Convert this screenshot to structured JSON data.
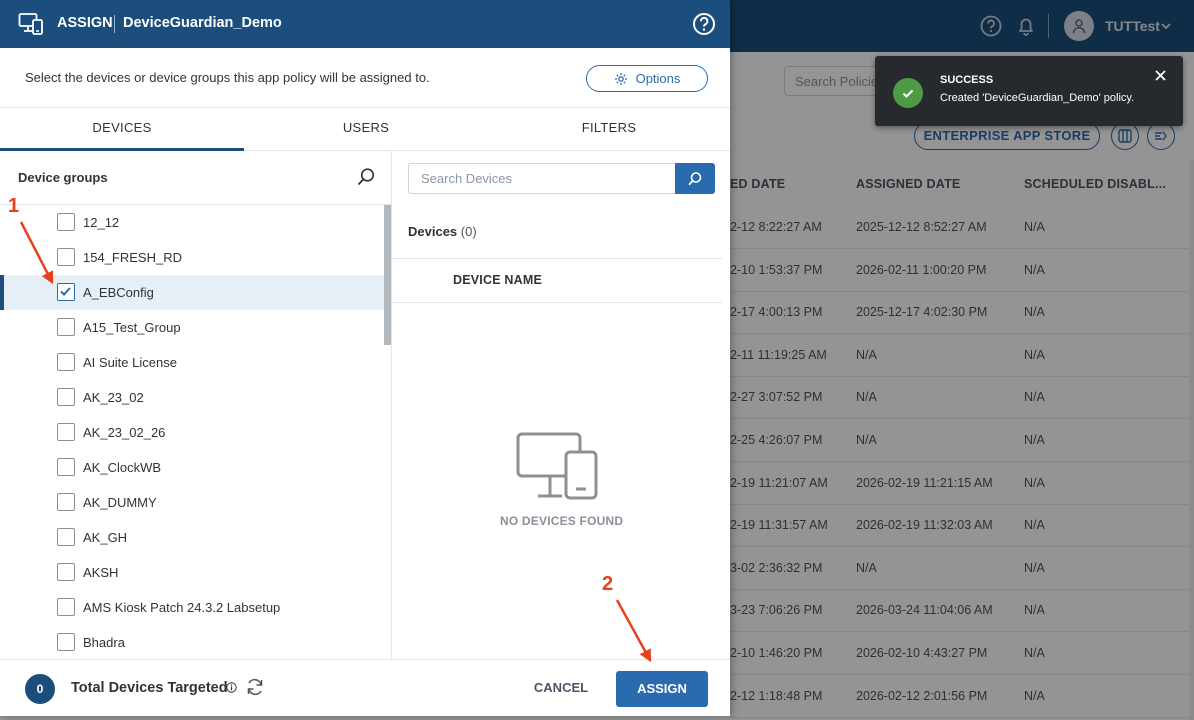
{
  "header": {
    "user_name": "TUTTest",
    "icons": [
      "help-icon",
      "bell-icon",
      "user-icon",
      "chevron-down-icon"
    ]
  },
  "background": {
    "search_placeholder": "Search Policies",
    "enterprise_app_store_label": "ENTERPRISE APP STORE",
    "columns": [
      "ED DATE",
      "ASSIGNED DATE",
      "SCHEDULED DISABL..."
    ],
    "rows": [
      {
        "created": "2-12 8:22:27 AM",
        "assigned": "2025-12-12 8:52:27 AM",
        "scheduled": "N/A"
      },
      {
        "created": "2-10 1:53:37 PM",
        "assigned": "2026-02-11 1:00:20 PM",
        "scheduled": "N/A"
      },
      {
        "created": "2-17 4:00:13 PM",
        "assigned": "2025-12-17 4:02:30 PM",
        "scheduled": "N/A"
      },
      {
        "created": "2-11 11:19:25 AM",
        "assigned": "N/A",
        "scheduled": "N/A"
      },
      {
        "created": "2-27 3:07:52 PM",
        "assigned": "N/A",
        "scheduled": "N/A"
      },
      {
        "created": "2-25 4:26:07 PM",
        "assigned": "N/A",
        "scheduled": "N/A"
      },
      {
        "created": "2-19 11:21:07 AM",
        "assigned": "2026-02-19 11:21:15 AM",
        "scheduled": "N/A"
      },
      {
        "created": "2-19 11:31:57 AM",
        "assigned": "2026-02-19 11:32:03 AM",
        "scheduled": "N/A"
      },
      {
        "created": "3-02 2:36:32 PM",
        "assigned": "N/A",
        "scheduled": "N/A"
      },
      {
        "created": "3-23 7:06:26 PM",
        "assigned": "2026-03-24 11:04:06 AM",
        "scheduled": "N/A"
      },
      {
        "created": "2-10 1:46:20 PM",
        "assigned": "2026-02-10 4:43:27 PM",
        "scheduled": "N/A"
      },
      {
        "created": "2-12 1:18:48 PM",
        "assigned": "2026-02-12 2:01:56 PM",
        "scheduled": "N/A"
      }
    ]
  },
  "toast": {
    "title": "SUCCESS",
    "message": "Created 'DeviceGuardian_Demo' policy.",
    "status_color": "#4f9a46"
  },
  "modal": {
    "title": "ASSIGN",
    "policy_name": "DeviceGuardian_Demo",
    "description": "Select the devices or device groups this app policy will be assigned to.",
    "options_label": "Options",
    "tabs": [
      {
        "label": "DEVICES",
        "active": true
      },
      {
        "label": "USERS",
        "active": false
      },
      {
        "label": "FILTERS",
        "active": false
      }
    ],
    "groups_title": "Device groups",
    "groups": [
      {
        "label": "12_12",
        "checked": false
      },
      {
        "label": "154_FRESH_RD",
        "checked": false
      },
      {
        "label": "A_EBConfig",
        "checked": true
      },
      {
        "label": "A15_Test_Group",
        "checked": false
      },
      {
        "label": "AI Suite License",
        "checked": false
      },
      {
        "label": "AK_23_02",
        "checked": false
      },
      {
        "label": "AK_23_02_26",
        "checked": false
      },
      {
        "label": "AK_ClockWB",
        "checked": false
      },
      {
        "label": "AK_DUMMY",
        "checked": false
      },
      {
        "label": "AK_GH",
        "checked": false
      },
      {
        "label": "AKSH",
        "checked": false
      },
      {
        "label": "AMS Kiosk Patch 24.3.2 Labsetup",
        "checked": false
      },
      {
        "label": "Bhadra",
        "checked": false
      }
    ],
    "device_search_placeholder": "Search Devices",
    "devices_title": "Devices",
    "devices_count": "(0)",
    "device_column": "DEVICE NAME",
    "no_devices_text": "NO DEVICES FOUND",
    "total_count": "0",
    "total_label": "Total Devices Targeted",
    "cancel_label": "CANCEL",
    "assign_label": "ASSIGN",
    "accent_color": "#1c4e7d",
    "primary_color": "#2a6bb0"
  },
  "annotations": [
    {
      "label": "1",
      "color": "#e8401c"
    },
    {
      "label": "2",
      "color": "#e8401c"
    }
  ]
}
